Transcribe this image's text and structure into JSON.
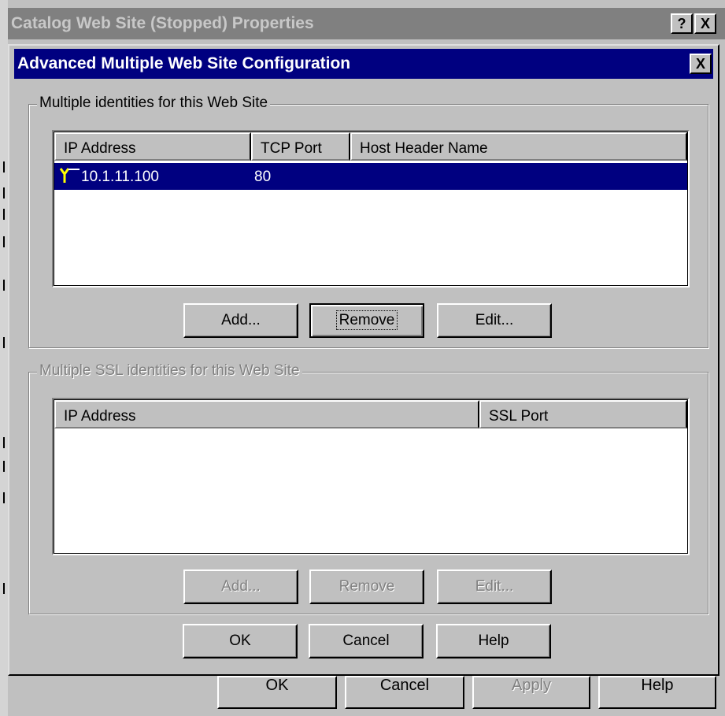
{
  "parent_window": {
    "title": "Catalog Web Site (Stopped) Properties",
    "help_glyph": "?",
    "close_glyph": "X",
    "buttons": {
      "ok": "OK",
      "cancel": "Cancel",
      "apply": "Apply",
      "help": "Help"
    }
  },
  "dialog": {
    "title": "Advanced Multiple Web Site Configuration",
    "close_glyph": "X",
    "identities": {
      "label": "Multiple identities for this Web Site",
      "columns": {
        "ip_address": "IP Address",
        "tcp_port": "TCP Port",
        "host_header": "Host Header Name"
      },
      "rows": [
        {
          "ip": "10.1.11.100",
          "port": "80",
          "host_header": "",
          "icon": "network-plug-icon",
          "selected": true
        }
      ],
      "buttons": {
        "add": "Add...",
        "remove": "Remove",
        "edit": "Edit..."
      }
    },
    "ssl_identities": {
      "label": "Multiple SSL identities for this Web Site",
      "columns": {
        "ip_address": "IP Address",
        "ssl_port": "SSL Port"
      },
      "rows": [],
      "buttons": {
        "add": "Add...",
        "remove": "Remove",
        "edit": "Edit..."
      }
    },
    "buttons": {
      "ok": "OK",
      "cancel": "Cancel",
      "help": "Help"
    }
  },
  "colors": {
    "face": "#c0c0c0",
    "active_title": "#000080",
    "inactive_title": "#808080",
    "selection": "#000080"
  }
}
